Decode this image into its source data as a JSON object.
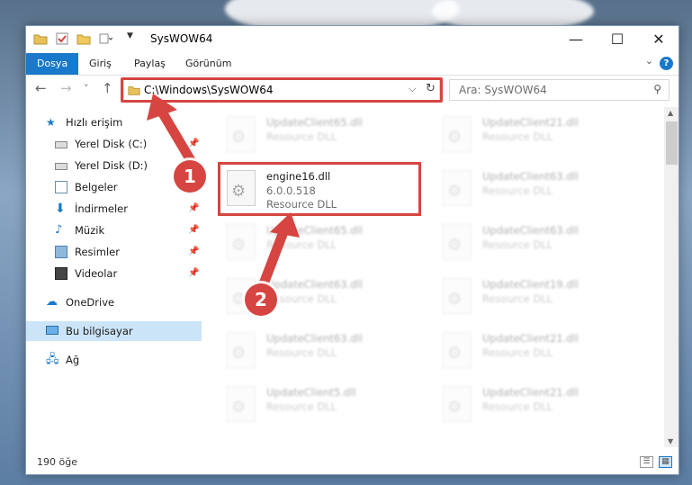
{
  "window": {
    "title": "SysWOW64"
  },
  "ribbon": {
    "tabs": [
      "Dosya",
      "Giriş",
      "Paylaş",
      "Görünüm"
    ],
    "help_label": "?"
  },
  "nav": {
    "back": "←",
    "forward": "→",
    "recent": "˅",
    "up": "↑",
    "address": "C:\\Windows\\SysWOW64",
    "search_placeholder": "Ara: SysWOW64"
  },
  "sidebar": {
    "items": [
      {
        "label": "Hızlı erişim",
        "icon": "star-icon",
        "pinned": false
      },
      {
        "label": "Yerel Disk (C:)",
        "icon": "drive-icon",
        "pinned": true
      },
      {
        "label": "Yerel Disk (D:)",
        "icon": "drive-icon",
        "pinned": true
      },
      {
        "label": "Belgeler",
        "icon": "document-icon",
        "pinned": true
      },
      {
        "label": "İndirmeler",
        "icon": "download-icon",
        "pinned": true
      },
      {
        "label": "Müzik",
        "icon": "music-icon",
        "pinned": true
      },
      {
        "label": "Resimler",
        "icon": "image-icon",
        "pinned": true
      },
      {
        "label": "Videolar",
        "icon": "video-icon",
        "pinned": true
      },
      {
        "label": "OneDrive",
        "icon": "cloud-icon",
        "pinned": false
      },
      {
        "label": "Bu bilgisayar",
        "icon": "computer-icon",
        "pinned": false
      },
      {
        "label": "Ağ",
        "icon": "network-icon",
        "pinned": false
      }
    ]
  },
  "files": [
    {
      "name": "UpdateClient65.dll",
      "desc": "Resource DLL"
    },
    {
      "name": "UpdateClient21.dll",
      "desc": "Resource DLL"
    },
    {
      "name": "engine16.dll",
      "version": "6.0.0.518",
      "desc": "Resource DLL"
    },
    {
      "name": "UpdateClient63.dll",
      "desc": "Resource DLL"
    },
    {
      "name": "UpdateClient65.dll",
      "desc": "Resource DLL"
    },
    {
      "name": "UpdateClient63.dll",
      "desc": "Resource DLL"
    },
    {
      "name": "UpdateClient63.dll",
      "desc": "Resource DLL"
    },
    {
      "name": "UpdateClient19.dll",
      "desc": "Resource DLL"
    },
    {
      "name": "UpdateClient63.dll",
      "desc": "Resource DLL"
    },
    {
      "name": "UpdateClient21.dll",
      "desc": "Resource DLL"
    },
    {
      "name": "UpdateClient5.dll",
      "desc": "Resource DLL"
    },
    {
      "name": "UpdateClient21.dll",
      "desc": "Resource DLL"
    }
  ],
  "status": {
    "count": "190 öğe"
  },
  "callouts": [
    "1",
    "2"
  ],
  "colors": {
    "accent": "#1979ca",
    "highlight": "#d64541",
    "selected": "#cce4f7"
  }
}
